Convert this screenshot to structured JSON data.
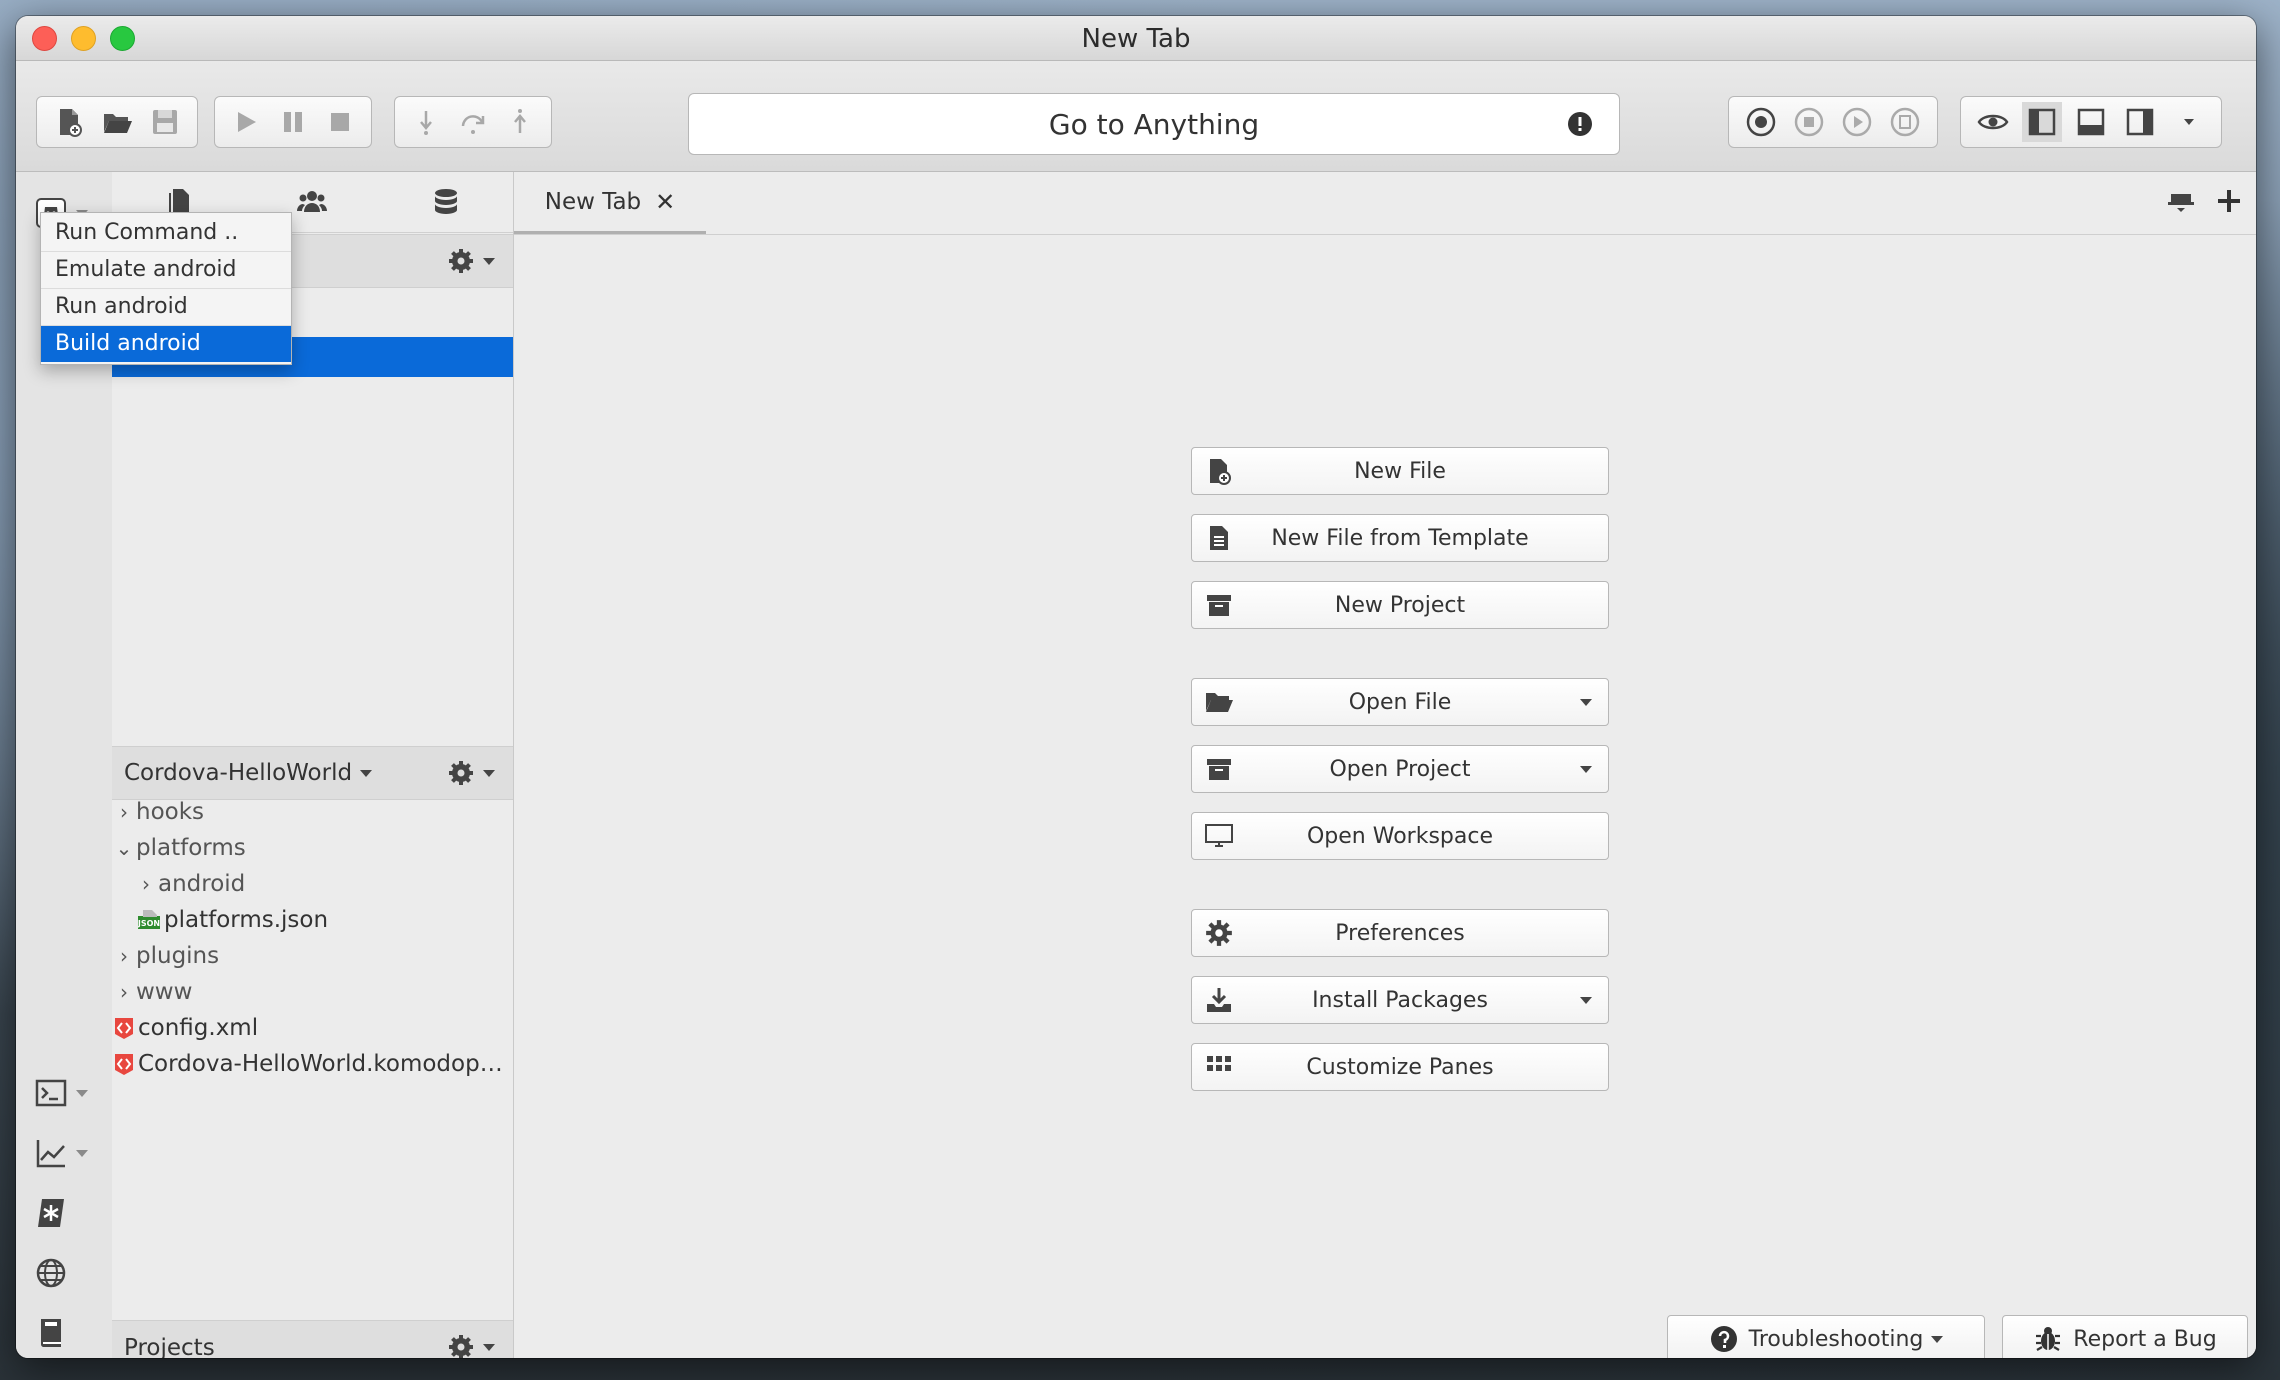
{
  "window": {
    "title": "New Tab"
  },
  "toolbar": {
    "goto_placeholder": "Go to Anything"
  },
  "rail_menu": {
    "items": [
      "Run Command ..",
      "Emulate android",
      "Run android",
      "Build android"
    ],
    "active_index": 3
  },
  "side": {
    "project_name": "Cordova-HelloWorld",
    "footer_label": "Projects",
    "tree": [
      {
        "label": "hooks",
        "type": "folder",
        "expanded": false,
        "depth": 0
      },
      {
        "label": "platforms",
        "type": "folder",
        "expanded": true,
        "depth": 0
      },
      {
        "label": "android",
        "type": "folder",
        "expanded": false,
        "depth": 1
      },
      {
        "label": "platforms.json",
        "type": "json",
        "depth": 1
      },
      {
        "label": "plugins",
        "type": "folder",
        "expanded": false,
        "depth": 0
      },
      {
        "label": "www",
        "type": "folder",
        "expanded": false,
        "depth": 0
      },
      {
        "label": "config.xml",
        "type": "xml",
        "depth": 0
      },
      {
        "label": "Cordova-HelloWorld.komodopr...",
        "type": "xml",
        "depth": 0
      }
    ]
  },
  "main": {
    "tab_label": "New Tab",
    "actions": {
      "new_file": "New File",
      "new_from_template": "New File from Template",
      "new_project": "New Project",
      "open_file": "Open File",
      "open_project": "Open Project",
      "open_workspace": "Open Workspace",
      "preferences": "Preferences",
      "install_packages": "Install Packages",
      "customize_panes": "Customize Panes"
    },
    "footer": {
      "troubleshooting": "Troubleshooting",
      "report_bug": "Report a Bug"
    }
  },
  "colors": {
    "accent": "#0a6ad9",
    "json_icon": "#2e8b2e",
    "xml_icon": "#e8473f"
  }
}
